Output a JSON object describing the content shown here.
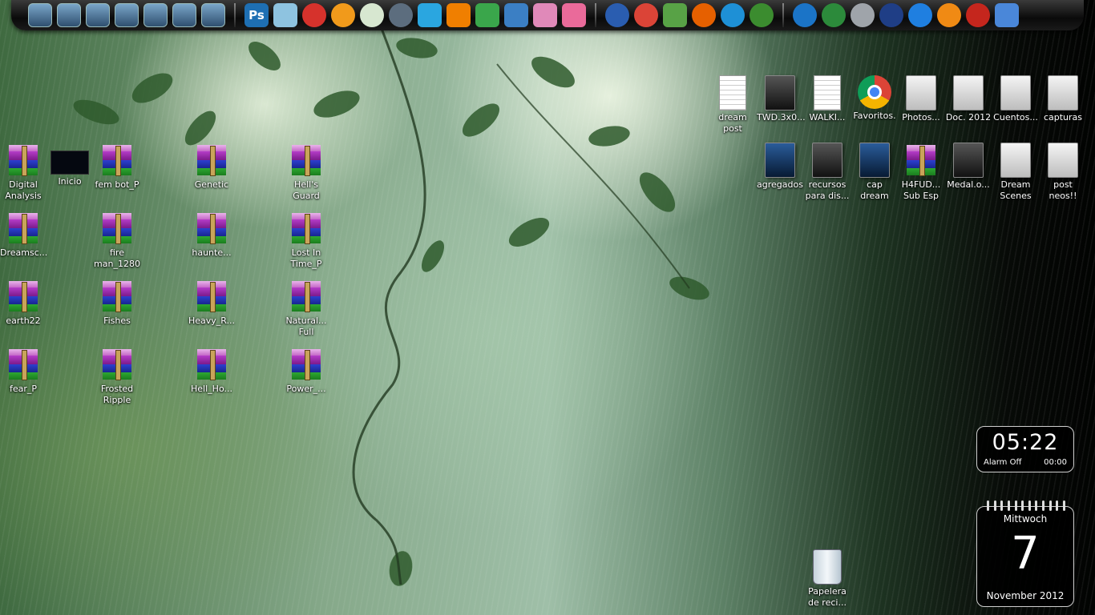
{
  "dock": {
    "group1": [
      "computer-icon",
      "documents-icon",
      "control-panel-icon",
      "camera-icon",
      "tools-icon",
      "download-icon",
      "usb-drive-icon"
    ],
    "group2": [
      {
        "icon": "photoshop-icon",
        "label": "Ps",
        "color": "#1e6fb3"
      },
      {
        "icon": "editor-icon",
        "label": "",
        "color": "#8ec3e0"
      },
      {
        "icon": "app-red-icon",
        "label": "",
        "color": "#d6322c"
      },
      {
        "icon": "aimp-icon",
        "label": "",
        "color": "#f19a1b"
      },
      {
        "icon": "eye-app-icon",
        "label": "",
        "color": "#d7e7d0"
      },
      {
        "icon": "refresh-icon",
        "label": "",
        "color": "#5c6d7e"
      },
      {
        "icon": "media-player-icon",
        "label": "",
        "color": "#2aa6e0"
      },
      {
        "icon": "vlc-icon",
        "label": "",
        "color": "#f07f00"
      },
      {
        "icon": "gecko-icon",
        "label": "",
        "color": "#3aa64b"
      },
      {
        "icon": "network-tool-icon",
        "label": "",
        "color": "#3b7fc4"
      },
      {
        "icon": "package-icon",
        "label": "",
        "color": "#e089b9"
      },
      {
        "icon": "screen-capture-icon",
        "label": "",
        "color": "#ea6a9a"
      }
    ],
    "group3": [
      {
        "icon": "google-earth-icon",
        "color": "#2a5db0"
      },
      {
        "icon": "chrome-icon",
        "color": "#db4437"
      },
      {
        "icon": "image-viewer-icon",
        "color": "#58a246"
      },
      {
        "icon": "firefox-icon",
        "color": "#e66000"
      },
      {
        "icon": "internet-explorer-icon",
        "color": "#1e90d6"
      },
      {
        "icon": "media-center-icon",
        "color": "#3b8c2f"
      }
    ],
    "group4": [
      {
        "icon": "settings-icon",
        "color": "#1b74c7"
      },
      {
        "icon": "sphere-app-icon",
        "color": "#2c8a3b"
      },
      {
        "icon": "disc-icon",
        "color": "#9fa4aa"
      },
      {
        "icon": "hulu-icon",
        "color": "#1f3e86"
      },
      {
        "icon": "power-app-icon",
        "color": "#1f7fe0"
      },
      {
        "icon": "avast-icon",
        "color": "#f08a14"
      },
      {
        "icon": "burn-icon",
        "color": "#c5261d"
      },
      {
        "icon": "control-widget-icon",
        "color": "#4a87d9"
      }
    ]
  },
  "desktop_left": [
    {
      "label": "Digital Analysis",
      "type": "rar"
    },
    {
      "label": "Inicio",
      "type": "thumb"
    },
    {
      "label": "fem bot_P",
      "type": "rar"
    },
    {
      "label": "Genetic",
      "type": "rar"
    },
    {
      "label": "Hell's Guard",
      "type": "rar"
    },
    {
      "label": "Dreamsc...",
      "type": "rar"
    },
    {
      "label": "fire man_1280",
      "type": "rar"
    },
    {
      "label": "haunte...",
      "type": "rar"
    },
    {
      "label": "Lost In Time_P",
      "type": "rar"
    },
    {
      "label": "earth22",
      "type": "rar"
    },
    {
      "label": "Fishes",
      "type": "rar"
    },
    {
      "label": "Heavy_R...",
      "type": "rar"
    },
    {
      "label": "Natural... Full",
      "type": "rar"
    },
    {
      "label": "fear_P",
      "type": "rar"
    },
    {
      "label": "Frosted Ripple",
      "type": "rar"
    },
    {
      "label": "Hell_Ho...",
      "type": "rar"
    },
    {
      "label": "Power_...",
      "type": "rar"
    }
  ],
  "desktop_right": [
    {
      "label": "dream post",
      "type": "doc"
    },
    {
      "label": "TWD.3x0...",
      "type": "folder-dark"
    },
    {
      "label": "WALKI...",
      "type": "doc"
    },
    {
      "label": "Favoritos.",
      "type": "chrome"
    },
    {
      "label": "Photos...",
      "type": "folder"
    },
    {
      "label": "Doc. 2012",
      "type": "folder"
    },
    {
      "label": "Cuentos...",
      "type": "folder"
    },
    {
      "label": "capturas",
      "type": "folder"
    },
    {
      "label": "agregados",
      "type": "folder-blue"
    },
    {
      "label": "recursos para dis...",
      "type": "folder-dark"
    },
    {
      "label": "cap dream",
      "type": "folder-blue"
    },
    {
      "label": "H4FUD... Sub Esp",
      "type": "rar"
    },
    {
      "label": "Medal.o...",
      "type": "folder-dark"
    },
    {
      "label": "Dream Scenes",
      "type": "folder"
    },
    {
      "label": "post neos!!",
      "type": "folder"
    }
  ],
  "recycle_bin": {
    "label": "Papelera de reci..."
  },
  "clock_widget": {
    "time": "05:22",
    "alarm_label": "Alarm Off",
    "alarm_time": "00:00"
  },
  "calendar_widget": {
    "weekday": "Mittwoch",
    "day": "7",
    "month_year": "November 2012"
  }
}
